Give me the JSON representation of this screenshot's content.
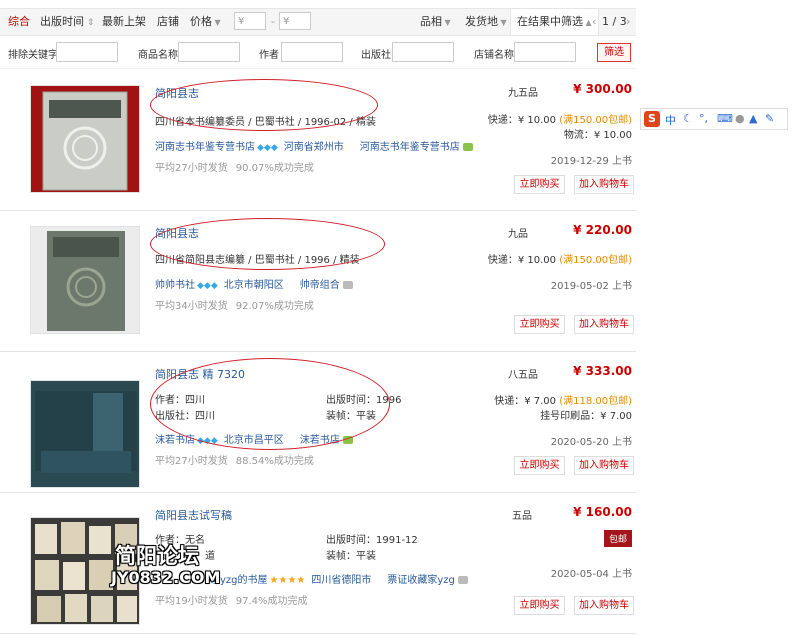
{
  "sortbar": {
    "comprehensive": "综合",
    "pubtime": "出版时间",
    "newest": "最新上架",
    "shop": "店铺",
    "price": "价格",
    "price_from": "¥",
    "price_to": "¥",
    "price_dash": "-",
    "quality": "品相",
    "ship_from": "发货地",
    "filter_in_results": "在结果中筛选",
    "page_indicator": "1 / 3"
  },
  "filters": {
    "exclude_kw": "排除关键字",
    "product_name": "商品名称",
    "author": "作者",
    "publisher": "出版社",
    "shop_name": "店铺名称",
    "submit": "筛选"
  },
  "items": [
    {
      "title": "简阳县志",
      "meta": "四川省本书编纂委员 / 巴蜀书社 / 1996-02 / 精装",
      "shop": "河南志书年鉴专营书店",
      "loc": "河南省郑州市",
      "seller": "河南志书年鉴专营书店",
      "stats_ship": "平均27小时发货",
      "stats_rate": "90.07%成功完成",
      "cond": "九五品",
      "price": "¥ 300.00",
      "ship": "快递：¥ 10.00",
      "free": "(满150.00包邮)",
      "ship2": "物流：¥ 10.00",
      "date": "2019-12-29 上书"
    },
    {
      "title": "简阳县志",
      "meta": "四川省简阳县志编纂 / 巴蜀书社 / 1996 / 精装",
      "shop": "帅帅书社",
      "loc": "北京市朝阳区",
      "seller": "帅帝组合",
      "stats_ship": "平均34小时发货",
      "stats_rate": "92.07%成功完成",
      "cond": "九品",
      "price": "¥ 220.00",
      "ship": "快递：¥ 10.00",
      "free": "(满150.00包邮)",
      "date": "2019-05-02 上书"
    },
    {
      "title": "简阳县志",
      "title_extra": "精 7320",
      "author_label": "作者：四川",
      "publisher_label": "出版社：四川",
      "pubtime_label": "出版时间：1996",
      "binding_label": "装帧：平装",
      "shop": "沫若书店",
      "loc": "北京市昌平区",
      "seller": "沫若书店",
      "stats_ship": "平均27小时发货",
      "stats_rate": "88.54%成功完成",
      "cond": "八五品",
      "price": "¥ 333.00",
      "ship": "快递：¥ 7.00",
      "free": "(满118.00包邮)",
      "ship2": "挂号印刷品：¥ 7.00",
      "date": "2020-05-20 上书"
    },
    {
      "title": "简阳县志试写稿",
      "author_label": "作者：无名",
      "publisher_label": "道",
      "pubtime_label": "出版时间：1991-12",
      "binding_label": "装帧：平装",
      "shop": "家yzg的书屋",
      "loc": "四川省德阳市",
      "seller": "票证收藏家yzg",
      "stats_ship": "平均19小时发货",
      "stats_rate": "97.4%成功完成",
      "cond": "五品",
      "price": "¥ 160.00",
      "badge": "包邮",
      "date": "2020-05-04 上书"
    }
  ],
  "buttons": {
    "buy_now": "立即购买",
    "add_cart": "加入购物车"
  },
  "ime": {
    "logo": "S",
    "lang": "中"
  },
  "watermark": {
    "line1": "简阳论坛",
    "line2": "JY0832.COM"
  },
  "colors": {
    "accent": "#cc0000",
    "link": "#2a5a9a",
    "free_ship": "#e58a00",
    "annotation": "#d0212a"
  }
}
